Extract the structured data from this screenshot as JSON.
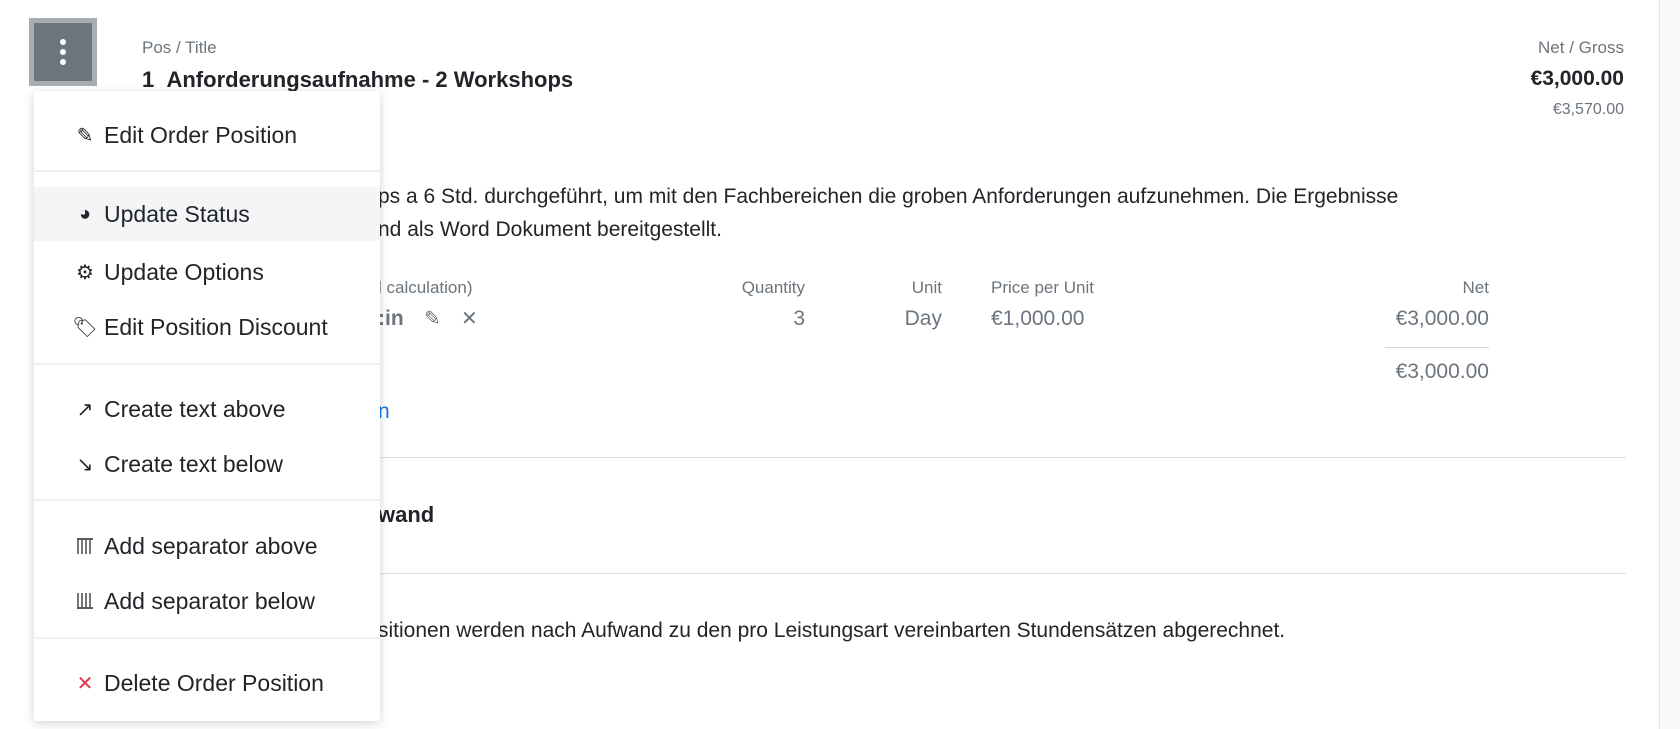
{
  "position": {
    "header_left_label": "Pos / Title",
    "number": "1",
    "title": "Anforderungsaufnahme - 2 Workshops",
    "header_right_label": "Net / Gross",
    "net": "€3,000.00",
    "gross": "€3,570.00",
    "description_line1": "ps a 6 Std. durchgeführt, um mit den Fachbereichen die groben Anforderungen aufzunehmen. Die Ergebnisse",
    "description_line2": "nd als Word Dokument bereitgestellt."
  },
  "calc_table": {
    "headers": {
      "name": "l calculation)",
      "quantity": "Quantity",
      "unit": "Unit",
      "price": "Price per Unit",
      "net": "Net"
    },
    "rows": [
      {
        "name": ":in",
        "quantity": "3",
        "unit": "Day",
        "price": "€1,000.00",
        "net": "€3,000.00"
      }
    ],
    "total": "€3,000.00",
    "link_fragment": "n"
  },
  "next_section": {
    "title_fragment": "wand",
    "text_fragment": "sitionen werden nach Aufwand zu den pro Leistungsart vereinbarten Stundensätzen abgerechnet."
  },
  "menu": {
    "items": [
      {
        "label": "Edit Order Position",
        "icon": "pencil-icon"
      },
      {
        "label": "Update Status",
        "icon": "status-icon"
      },
      {
        "label": "Update Options",
        "icon": "gear-icon"
      },
      {
        "label": "Edit Position Discount",
        "icon": "tag-icon"
      },
      {
        "label": "Create text above",
        "icon": "arrow-up-right-icon"
      },
      {
        "label": "Create text below",
        "icon": "arrow-down-right-icon"
      },
      {
        "label": "Add separator above",
        "icon": "separator-above-icon"
      },
      {
        "label": "Add separator below",
        "icon": "separator-below-icon"
      },
      {
        "label": "Delete Order Position",
        "icon": "close-icon"
      }
    ]
  },
  "colors": {
    "delete": "#dc3545",
    "link": "#1a73e8",
    "kebab": "#6c747c"
  }
}
